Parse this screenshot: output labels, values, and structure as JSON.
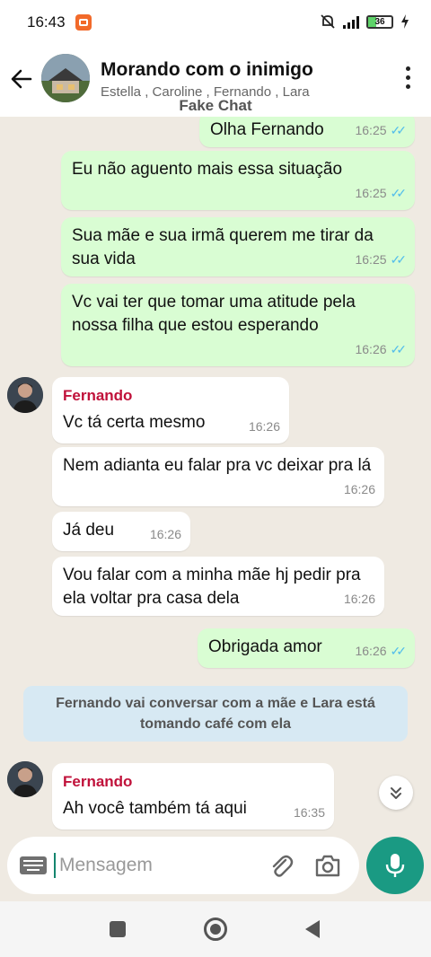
{
  "status_bar": {
    "time": "16:43",
    "battery": "36"
  },
  "header": {
    "title": "Morando com o inimigo",
    "participants": "Estella , Caroline , Fernando , Lara",
    "watermark": "Fake Chat"
  },
  "messages": [
    {
      "text": "Olha Fernando",
      "time": "16:25"
    },
    {
      "text": "Eu não aguento mais essa situação",
      "time": "16:25"
    },
    {
      "text": "Sua mãe e sua irmã querem me tirar da sua vida",
      "time": "16:25"
    },
    {
      "text": "Vc vai ter que tomar uma atitude pela nossa filha que estou esperando",
      "time": "16:26"
    },
    {
      "sender": "Fernando",
      "text": "Vc tá certa mesmo",
      "time": "16:26"
    },
    {
      "text": "Nem adianta eu falar pra vc deixar pra lá",
      "time": "16:26"
    },
    {
      "text": "Já deu",
      "time": "16:26"
    },
    {
      "text": "Vou falar com a minha mãe hj pedir pra ela voltar pra casa dela",
      "time": "16:26"
    },
    {
      "text": "Obrigada amor",
      "time": "16:26"
    },
    {
      "sender": "Fernando",
      "text": "Ah você também tá aqui",
      "time": "16:35"
    }
  ],
  "system_message": "Fernando vai conversar com a mãe e Lara está tomando café com ela",
  "composer": {
    "placeholder": "Mensagem"
  },
  "colors": {
    "outgoing_bubble": "#d9fdd3",
    "incoming_bubble": "#ffffff",
    "sender_name": "#c0113a",
    "read_ticks": "#53bdeb",
    "accent": "#1a9a83",
    "system_bubble": "#d7e9f3"
  },
  "icons": [
    "back-arrow-icon",
    "more-vert-icon",
    "keyboard-icon",
    "attach-icon",
    "camera-icon",
    "mic-icon",
    "scroll-down-icon"
  ]
}
